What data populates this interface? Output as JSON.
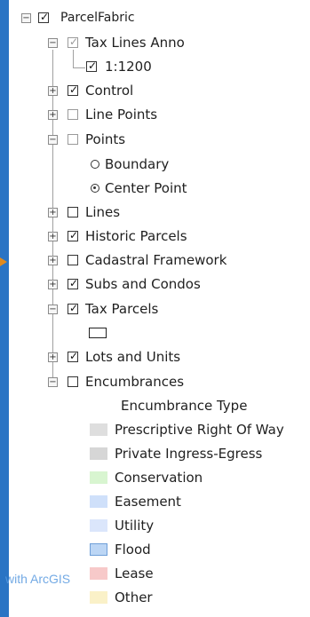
{
  "tree": {
    "root": {
      "label": "ParcelFabric",
      "checked": true
    },
    "tax_lines_anno": {
      "label": "Tax Lines Anno",
      "checked": true,
      "disabled": true
    },
    "scale_1200": {
      "label": "1:1200",
      "checked": true
    },
    "control": {
      "label": "Control",
      "checked": true
    },
    "line_points": {
      "label": "Line Points",
      "checked": false
    },
    "points": {
      "label": "Points",
      "checked": false
    },
    "boundary": {
      "label": "Boundary"
    },
    "center_point": {
      "label": "Center Point"
    },
    "lines": {
      "label": "Lines",
      "checked": false
    },
    "historic_parcels": {
      "label": "Historic Parcels",
      "checked": true
    },
    "cadastral_framework": {
      "label": "Cadastral Framework",
      "checked": false
    },
    "subs_and_condos": {
      "label": "Subs and Condos",
      "checked": true
    },
    "tax_parcels": {
      "label": "Tax Parcels",
      "checked": true
    },
    "lots_and_units": {
      "label": "Lots and Units",
      "checked": true
    },
    "encumbrances": {
      "label": "Encumbrances",
      "checked": false
    },
    "encumbrance_type_header": "Encumbrance Type",
    "encumbrance_classes": [
      {
        "label": "Prescriptive Right Of Way",
        "color": "#dedede"
      },
      {
        "label": "Private Ingress-Egress",
        "color": "#d6d6d6"
      },
      {
        "label": "Conservation",
        "color": "#d8f5d0"
      },
      {
        "label": "Easement",
        "color": "#cfe0fa"
      },
      {
        "label": "Utility",
        "color": "#dbe6fb"
      },
      {
        "label": "Flood",
        "color": "#bcd6f5"
      },
      {
        "label": "Lease",
        "color": "#f7c9c9"
      },
      {
        "label": "Other",
        "color": "#faf1c8"
      }
    ]
  },
  "watermark": "with ArcGIS"
}
